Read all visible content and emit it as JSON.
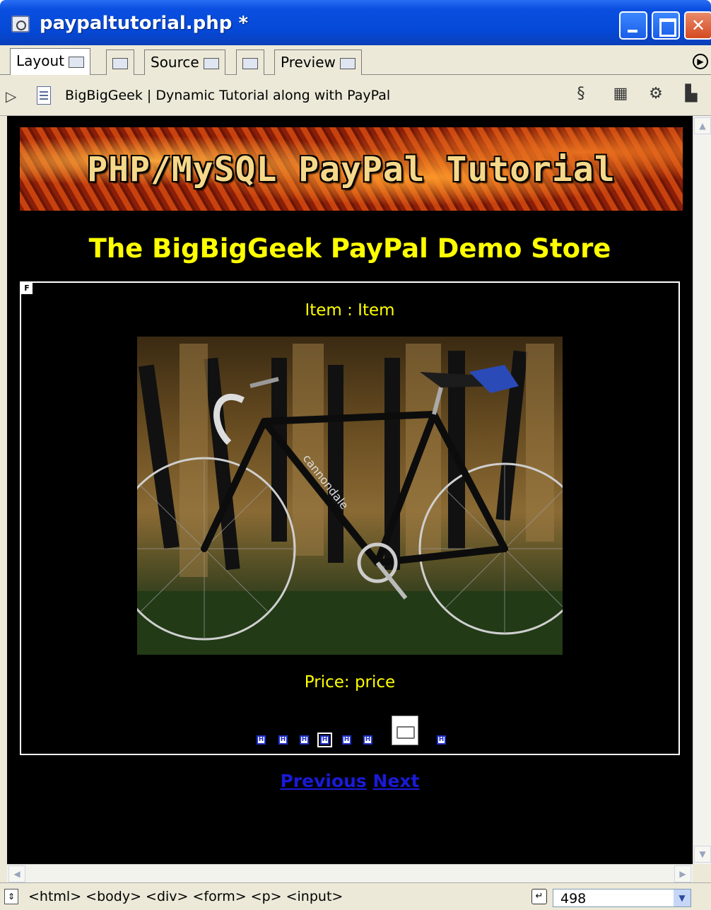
{
  "window": {
    "title": "paypaltutorial.php *"
  },
  "tabs": [
    {
      "label": "Layout"
    },
    {
      "label": ""
    },
    {
      "label": "Source"
    },
    {
      "label": ""
    },
    {
      "label": "Preview"
    }
  ],
  "doc_info": {
    "title": "BigBigGeek | Dynamic Tutorial along with PayPal"
  },
  "page": {
    "banner": "PHP/MySQL PayPal Tutorial",
    "heading": "The BigBigGeek PayPal Demo Store",
    "form_marker": "F",
    "item_label": "Item : Item",
    "price_label": "Price: price",
    "hidden_marker": "H",
    "nav": {
      "previous": "Previous",
      "next": "Next"
    }
  },
  "statusbar": {
    "tag_selector": "<html> <body> <div> <form> <p> <input>",
    "size": "498"
  },
  "colors": {
    "page_bg": "#000000",
    "heading": "#ffff00",
    "link": "#1a1ad8",
    "titlebar": "#0548d6"
  }
}
